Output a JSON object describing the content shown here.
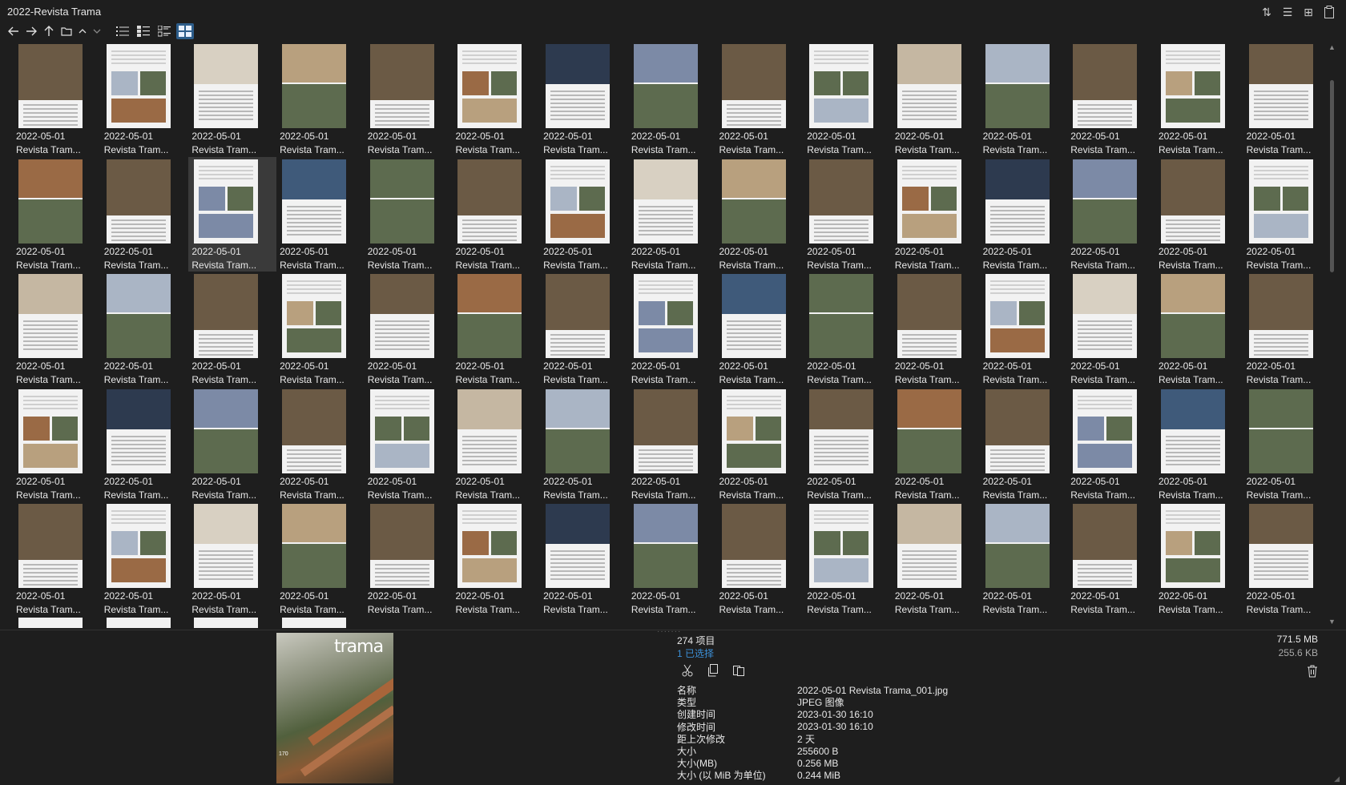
{
  "window": {
    "title": "2022-Revista Trama"
  },
  "title_actions": [
    {
      "name": "sort-icon",
      "glyph": "⇅"
    },
    {
      "name": "details-icon",
      "glyph": "☰"
    },
    {
      "name": "new-tab-icon",
      "glyph": "⊞"
    },
    {
      "name": "clipboard-icon",
      "glyph": "📋"
    }
  ],
  "nav": {
    "back": "←",
    "forward": "→",
    "up": "↑",
    "folder": "▭",
    "caret_up": "^",
    "caret_down": "v"
  },
  "view_modes": [
    {
      "name": "list-view-icon",
      "active": false
    },
    {
      "name": "details-view-icon",
      "active": false
    },
    {
      "name": "tiles-view-icon",
      "active": false
    },
    {
      "name": "thumbnails-view-icon",
      "active": true
    }
  ],
  "thumb_palette": [
    "#c5b7a2",
    "#7c8aa6",
    "#6b5a45",
    "#aab5c5",
    "#3f5a7a",
    "#9a6a45",
    "#d8d0c2",
    "#5d6b4f",
    "#2d3a4f",
    "#b8a07e"
  ],
  "file_grid": {
    "date": "2022-05-01",
    "name": "Revista Tram...",
    "rows": 5,
    "cols": 15,
    "selected_index": 17
  },
  "status": {
    "count": "274 项目",
    "selected": "1 已选择",
    "total_size": "771.5 MB",
    "selected_size": "255.6 KB"
  },
  "preview": {
    "logo": "trama",
    "issue": "170"
  },
  "properties": [
    {
      "key": "名称",
      "value": "2022-05-01 Revista Trama_001.jpg"
    },
    {
      "key": "类型",
      "value": "JPEG 图像"
    },
    {
      "key": "创建时间",
      "value": "2023-01-30  16:10"
    },
    {
      "key": "修改时间",
      "value": "2023-01-30  16:10"
    },
    {
      "key": "距上次修改",
      "value": "2 天"
    },
    {
      "key": "大小",
      "value": "255600 B"
    },
    {
      "key": "大小(MB)",
      "value": "0.256 MB"
    },
    {
      "key": "大小 (以 MiB 为单位)",
      "value": "0.244 MiB"
    }
  ]
}
